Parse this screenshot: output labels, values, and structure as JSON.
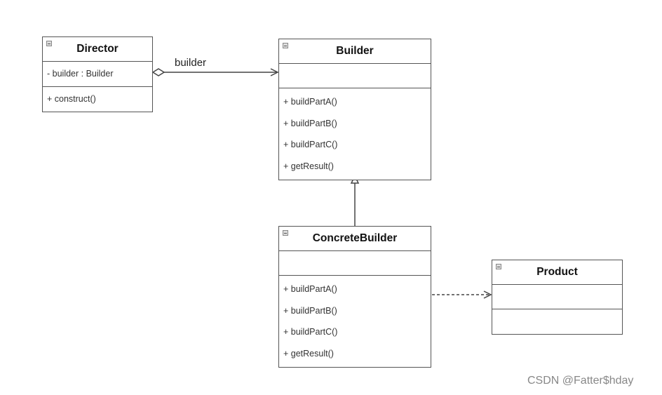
{
  "classes": [
    {
      "id": "director",
      "name": "Director",
      "attributes": [
        "- builder : Builder"
      ],
      "methods": [
        "+ construct()"
      ]
    },
    {
      "id": "builder",
      "name": "Builder",
      "attributes": [],
      "methods": [
        "+ buildPartA()",
        "+ buildPartB()",
        "+ buildPartC()",
        "+ getResult()"
      ]
    },
    {
      "id": "concrete-builder",
      "name": "ConcreteBuilder",
      "attributes": [],
      "methods": [
        "+ buildPartA()",
        "+ buildPartB()",
        "+ buildPartC()",
        "+ getResult()"
      ]
    },
    {
      "id": "product",
      "name": "Product",
      "attributes": [],
      "methods": []
    }
  ],
  "relations": [
    {
      "type": "aggregation",
      "from": "Director",
      "to": "Builder",
      "label": "builder"
    },
    {
      "type": "generalization",
      "from": "ConcreteBuilder",
      "to": "Builder"
    },
    {
      "type": "dependency",
      "from": "ConcreteBuilder",
      "to": "Product"
    }
  ],
  "watermark": "CSDN @Fatter$hday"
}
